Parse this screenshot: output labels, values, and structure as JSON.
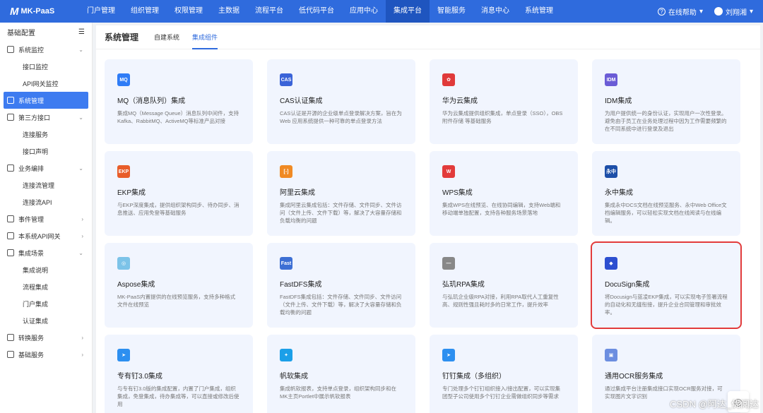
{
  "app": {
    "logo_mark": "M",
    "logo_text": "MK-PaaS"
  },
  "nav": [
    "门户管理",
    "组织管理",
    "权限管理",
    "主数据",
    "流程平台",
    "低代码平台",
    "应用中心",
    "集成平台",
    "智能服务",
    "消息中心",
    "系统管理"
  ],
  "nav_active_index": 7,
  "user": {
    "help": "在线帮助",
    "name": "刘翔湘"
  },
  "sidebar": {
    "header": "基础配置",
    "items": [
      {
        "label": "系统监控",
        "level": 0,
        "chev": "⌄"
      },
      {
        "label": "接口监控",
        "level": 1
      },
      {
        "label": "API网关监控",
        "level": 1
      },
      {
        "label": "系统管理",
        "level": 0,
        "active": true
      },
      {
        "label": "第三方接口",
        "level": 0,
        "chev": "⌄"
      },
      {
        "label": "连接服务",
        "level": 1
      },
      {
        "label": "接口声明",
        "level": 1
      },
      {
        "label": "业务编排",
        "level": 0,
        "chev": "⌄"
      },
      {
        "label": "连接流管理",
        "level": 1
      },
      {
        "label": "连接流API",
        "level": 1
      },
      {
        "label": "事件管理",
        "level": 0,
        "chev": "›"
      },
      {
        "label": "本系统API网关",
        "level": 0,
        "chev": "›"
      },
      {
        "label": "集成场景",
        "level": 0,
        "chev": "⌄"
      },
      {
        "label": "集成说明",
        "level": 1
      },
      {
        "label": "流程集成",
        "level": 1
      },
      {
        "label": "门户集成",
        "level": 1
      },
      {
        "label": "认证集成",
        "level": 1
      },
      {
        "label": "转换服务",
        "level": 0,
        "chev": "›"
      },
      {
        "label": "基础服务",
        "level": 0,
        "chev": "›"
      }
    ]
  },
  "main": {
    "title": "系统管理",
    "tabs": [
      "自建系统",
      "集成组件"
    ],
    "active_tab": 1
  },
  "cards": [
    {
      "icon_text": "MQ",
      "icon_color": "#2f7cf6",
      "title": "MQ（消息队列）集成",
      "desc": "集成MQ（Message Queue）消息队列中间件，支持Kafka、RabbitMQ、ActiveMQ等标准产品对接"
    },
    {
      "icon_text": "CAS",
      "icon_color": "#3a63d8",
      "title": "CAS认证集成",
      "desc": "CAS认证是开源的企业级单点登录解决方案，旨在为 Web 应用系统提供一种可靠的单点登录方法"
    },
    {
      "icon_text": "✿",
      "icon_color": "#e03a3a",
      "title": "华为云集成",
      "desc": "华为云集成提供组织集成，单点登录（SSO），OBS附件存储 等基础服务"
    },
    {
      "icon_text": "IDM",
      "icon_color": "#6b5cd6",
      "title": "IDM集成",
      "desc": "为用户提供统一的身份认证，实现用户一次性登录。避免由于员工在业务处理过程中因为工作需要频繁的在不同系统中进行登录及退出"
    },
    {
      "icon_text": "EKP",
      "icon_color": "#e85d2a",
      "title": "EKP集成",
      "desc": "与EKP深度集成，提供组织架构同步、待办同步、消息推送、应用免登等基础服务"
    },
    {
      "icon_text": "[-]",
      "icon_color": "#f08a24",
      "title": "阿里云集成",
      "desc": "集成阿里云集成包括：文件存储、文件同步、文件访问（文件上传、文件下载）等，解决了大容量存储和负载均衡的问题"
    },
    {
      "icon_text": "W",
      "icon_color": "#e23b3b",
      "title": "WPS集成",
      "desc": "集成WPS在线预览、在线协同编辑，支持Web端和移动端单独配置，支持各种服务场景落地"
    },
    {
      "icon_text": "永中",
      "icon_color": "#1d4fa8",
      "title": "永中集成",
      "desc": "集成永中DCS文档在线预览服务、永中Web Office文档编辑服务，可以轻松实现文档在线阅读与在线编辑。"
    },
    {
      "icon_text": "◎",
      "icon_color": "#7cc3e8",
      "title": "Aspose集成",
      "desc": "MK-PaaS内置提供的在线预览服务，支持多种格式文件在线预览"
    },
    {
      "icon_text": "Fast",
      "icon_color": "#3d6fd4",
      "title": "FastDFS集成",
      "desc": "FastDFS集成包括：文件存储、文件同步、文件访问（文件上传、文件下载）等，解决了大容量存储和负载均衡的问题"
    },
    {
      "icon_text": "—",
      "icon_color": "#888888",
      "title": "弘玑RPA集成",
      "desc": "与弘玑企业级RPA对接，利用RPA取代人工重复性高、规则性强且耗时多的日常工作，提升效率"
    },
    {
      "icon_text": "◆",
      "icon_color": "#2d4fd0",
      "title": "DocuSign集成",
      "desc": "将Docusign与蓝凌EKP集成，可以实现电子签署流程的自动化和无缝衔接，提升企业合同管理和审批效率。"
    },
    {
      "icon_text": "➤",
      "icon_color": "#2d8ff0",
      "title": "专有钉3.0集成",
      "desc": "与专有钉3.0版的集成配置，内置了门户集成，组织集成，免登集成，待办集成等，可以直接或修改后使用"
    },
    {
      "icon_text": "✦",
      "icon_color": "#1b9fe8",
      "title": "帆软集成",
      "desc": "集成帆软报表，支持单点登录，组织架构同步和在MK主页Portlet中展示帆软报表"
    },
    {
      "icon_text": "➤",
      "icon_color": "#2d8ff0",
      "title": "钉钉集成（多组织）",
      "desc": "专门处理多个钉钉组织接入/接出配置，可以实现集团型子公司使用多个钉钉企业需做组织同步等需求"
    },
    {
      "icon_text": "▣",
      "icon_color": "#6c8ee0",
      "title": "通用OCR服务集成",
      "desc": "通过集成平台注册集成接口实现OCR服务对接，可实现图片文字识别"
    }
  ],
  "highlight_index": 11,
  "float_icon": "headset-icon",
  "watermark": "CSDN @阿达_优阅达"
}
